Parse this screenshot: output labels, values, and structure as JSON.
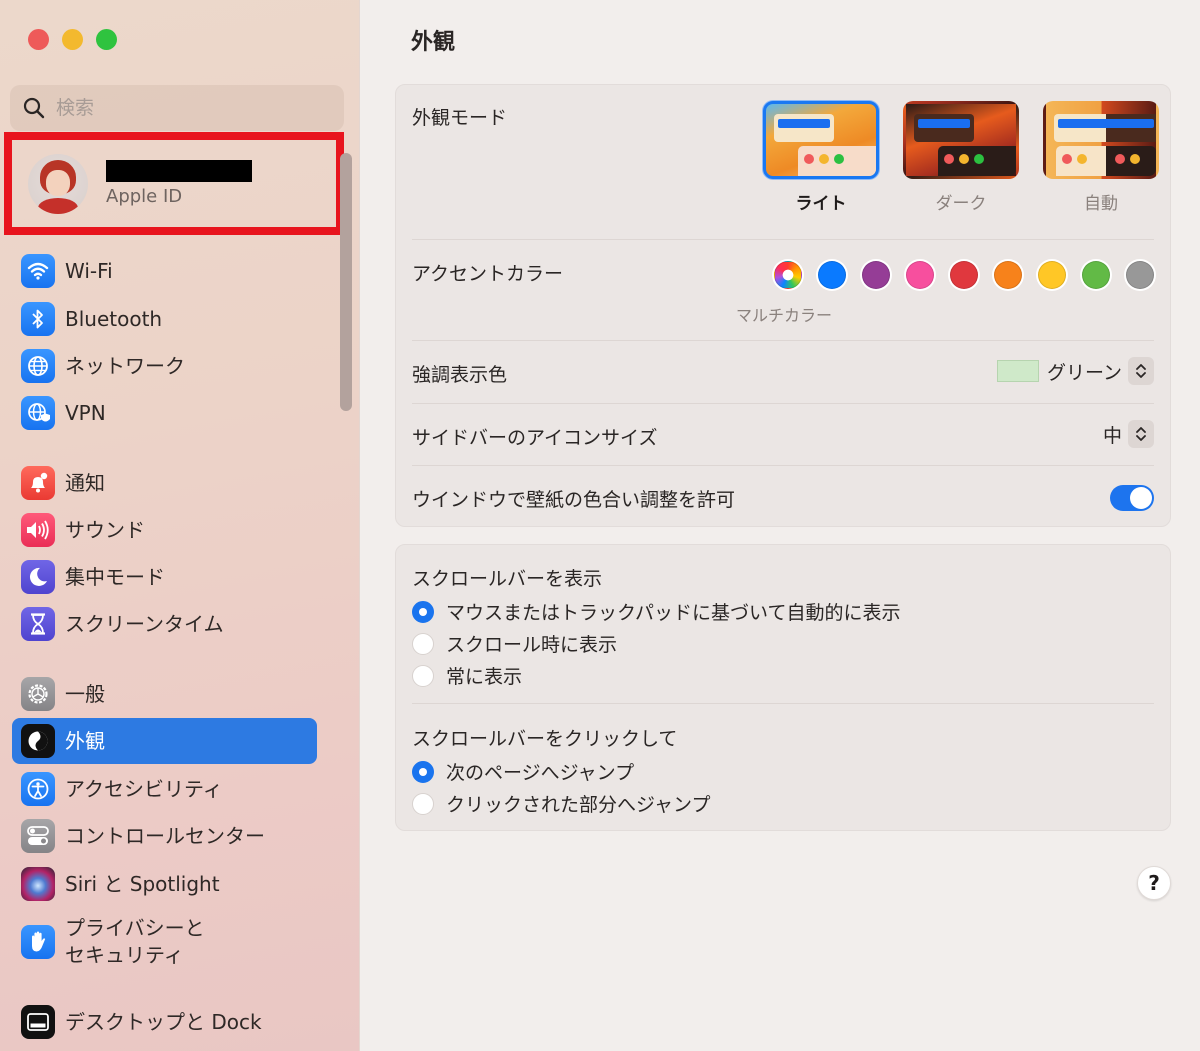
{
  "window": {
    "traffic_lights": [
      "close",
      "minimize",
      "maximize"
    ]
  },
  "sidebar": {
    "search_placeholder": "検索",
    "account": {
      "name_redacted": true,
      "subtitle": "Apple ID"
    },
    "groups": [
      [
        {
          "label": "Wi-Fi",
          "icon": "wifi-icon"
        },
        {
          "label": "Bluetooth",
          "icon": "bluetooth-icon"
        },
        {
          "label": "ネットワーク",
          "icon": "globe-icon"
        },
        {
          "label": "VPN",
          "icon": "vpn-icon"
        }
      ],
      [
        {
          "label": "通知",
          "icon": "bell-icon"
        },
        {
          "label": "サウンド",
          "icon": "speaker-icon"
        },
        {
          "label": "集中モード",
          "icon": "moon-icon"
        },
        {
          "label": "スクリーンタイム",
          "icon": "hourglass-icon"
        }
      ],
      [
        {
          "label": "一般",
          "icon": "gear-icon"
        },
        {
          "label": "外観",
          "icon": "appearance-icon",
          "selected": true
        },
        {
          "label": "アクセシビリティ",
          "icon": "accessibility-icon"
        },
        {
          "label": "コントロールセンター",
          "icon": "toggles-icon"
        },
        {
          "label": "Siri と Spotlight",
          "icon": "siri-icon"
        },
        {
          "label": "プライバシーと\nセキュリティ",
          "icon": "hand-icon"
        }
      ],
      [
        {
          "label": "デスクトップと Dock",
          "icon": "dock-icon"
        }
      ]
    ]
  },
  "main": {
    "title": "外観",
    "appearance_mode": {
      "label": "外観モード",
      "options": [
        {
          "label": "ライト",
          "selected": true
        },
        {
          "label": "ダーク",
          "selected": false
        },
        {
          "label": "自動",
          "selected": false
        }
      ]
    },
    "accent_color": {
      "label": "アクセントカラー",
      "selected_caption": "マルチカラー",
      "colors": [
        {
          "name": "multicolor",
          "hex": "multicolor"
        },
        {
          "name": "blue",
          "hex": "#0a7aff"
        },
        {
          "name": "purple",
          "hex": "#953d96"
        },
        {
          "name": "pink",
          "hex": "#f74f9e"
        },
        {
          "name": "red",
          "hex": "#e0383e"
        },
        {
          "name": "orange",
          "hex": "#f7821b"
        },
        {
          "name": "yellow",
          "hex": "#ffc726"
        },
        {
          "name": "green",
          "hex": "#62ba46"
        },
        {
          "name": "graphite",
          "hex": "#989898"
        }
      ]
    },
    "highlight_color": {
      "label": "強調表示色",
      "value": "グリーン",
      "swatch": "#cfe9c9"
    },
    "sidebar_icon_size": {
      "label": "サイドバーのアイコンサイズ",
      "value": "中"
    },
    "wallpaper_tinting": {
      "label": "ウインドウで壁紙の色合い調整を許可",
      "enabled": true
    },
    "show_scrollbars": {
      "label": "スクロールバーを表示",
      "options": [
        {
          "label": "マウスまたはトラックパッドに基づいて自動的に表示",
          "selected": true
        },
        {
          "label": "スクロール時に表示",
          "selected": false
        },
        {
          "label": "常に表示",
          "selected": false
        }
      ]
    },
    "click_scrollbar": {
      "label": "スクロールバーをクリックして",
      "options": [
        {
          "label": "次のページへジャンプ",
          "selected": true
        },
        {
          "label": "クリックされた部分へジャンプ",
          "selected": false
        }
      ]
    },
    "help_label": "?"
  },
  "colors": {
    "accent": "#1a74ee",
    "sidebar_selection": "#2d7ae2",
    "annotation_box": "#e8141d"
  }
}
